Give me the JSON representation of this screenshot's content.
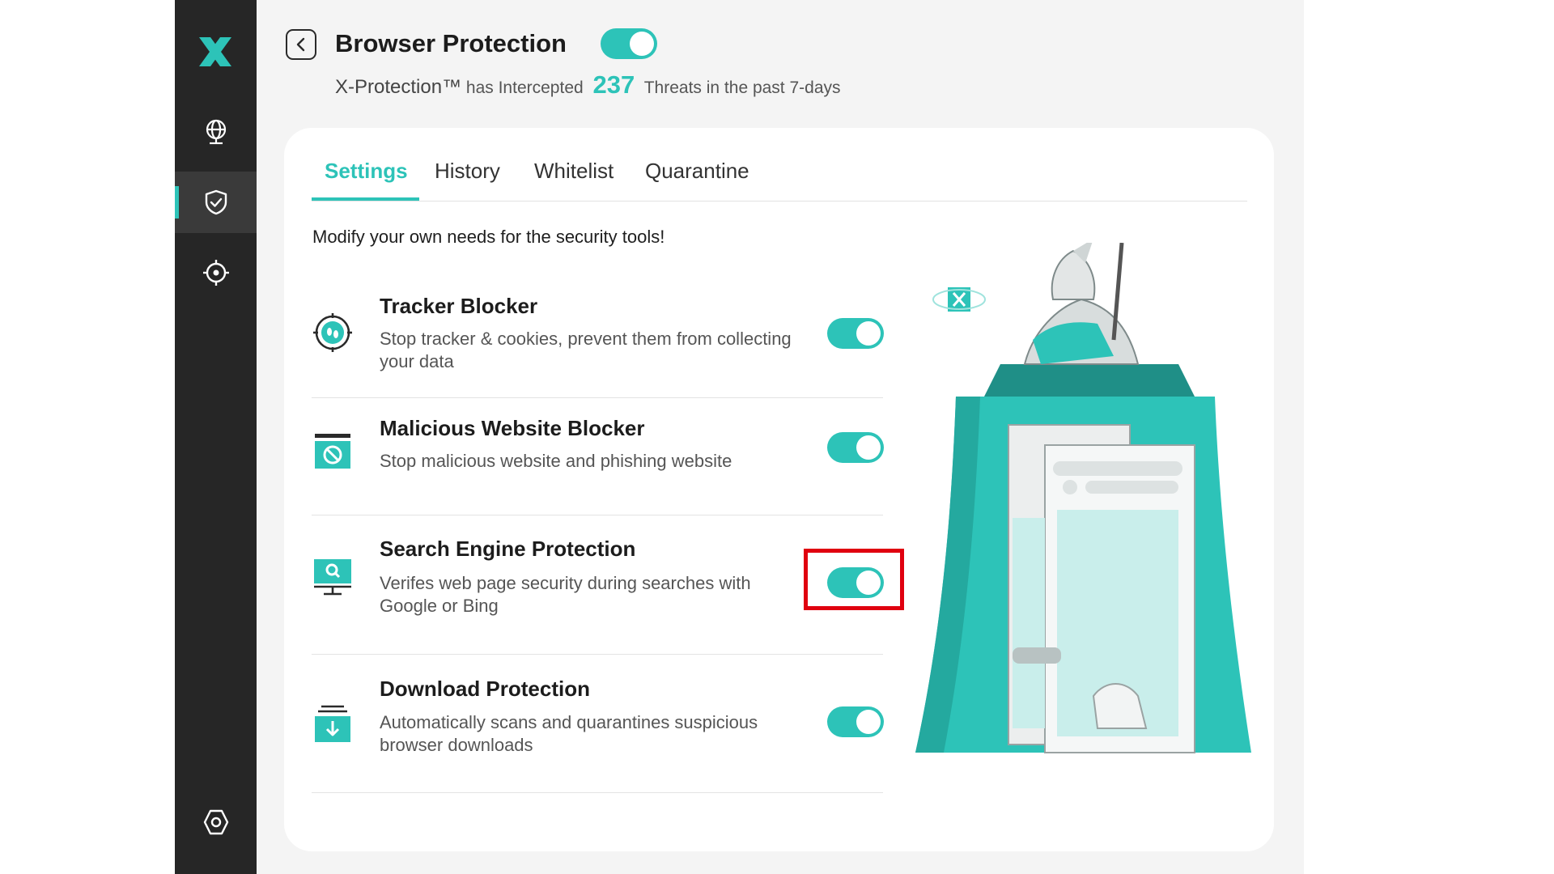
{
  "header": {
    "title": "Browser Protection",
    "protection_enabled": true,
    "brand": "X-Protection™",
    "intercept_text": "has Intercepted",
    "threat_count": "237",
    "period_text": "Threats in the past 7-days"
  },
  "tabs": [
    {
      "label": "Settings",
      "active": true
    },
    {
      "label": "History",
      "active": false
    },
    {
      "label": "Whitelist",
      "active": false
    },
    {
      "label": "Quarantine",
      "active": false
    }
  ],
  "intro": "Modify your own needs for the security tools!",
  "features": [
    {
      "title": "Tracker Blocker",
      "desc": "Stop tracker & cookies, prevent them from collecting your data",
      "enabled": true,
      "icon": "tracker-icon"
    },
    {
      "title": "Malicious Website Blocker",
      "desc": "Stop malicious website and phishing website",
      "enabled": true,
      "icon": "blocked-site-icon"
    },
    {
      "title": "Search Engine Protection",
      "desc": "Verifes web page security during searches with Google or Bing",
      "enabled": true,
      "icon": "search-monitor-icon"
    },
    {
      "title": "Download Protection",
      "desc": "Automatically scans and quarantines suspicious browser downloads",
      "enabled": true,
      "icon": "download-icon"
    }
  ],
  "sidebar": {
    "items": [
      {
        "icon": "globe-icon",
        "active": false
      },
      {
        "icon": "shield-check-icon",
        "active": true
      },
      {
        "icon": "crosshair-icon",
        "active": false
      }
    ],
    "bottom_icon": "settings-hex-icon"
  },
  "colors": {
    "accent": "#2dc3b8",
    "sidebar": "#262626",
    "highlight": "#e0000f"
  }
}
